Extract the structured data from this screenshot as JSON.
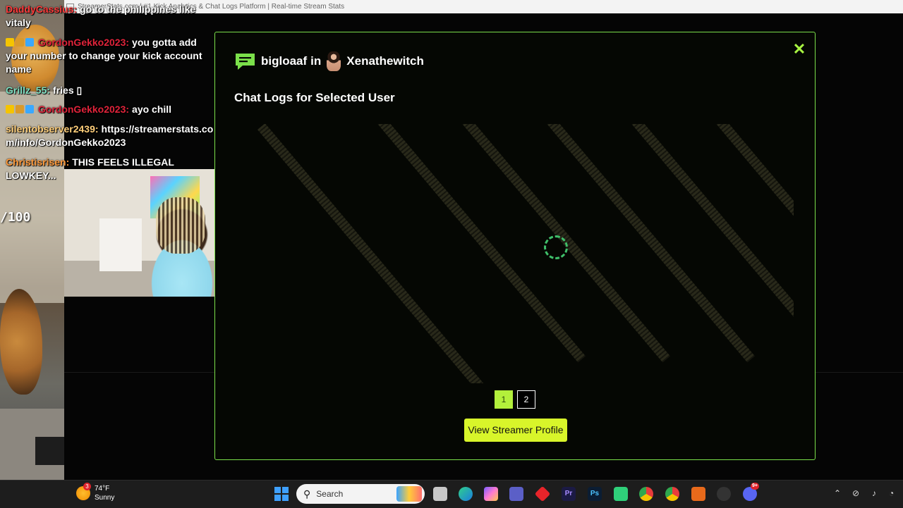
{
  "browser": {
    "title": "StreamerStats.com | #1 Kick Analytics & Chat Logs Platform | Real-time Stream Stats"
  },
  "chat_overlay": {
    "messages": [
      {
        "user": "DaddyCassius:",
        "text": "go to the philippines like vitaly",
        "color": "#ff3b3b"
      },
      {
        "user": "GordonGekko2023:",
        "text": "you gotta add your number to change your kick account name",
        "color": "#e0233a"
      },
      {
        "user": "Grillz_55:",
        "text": "fries ▯",
        "color": "#7ee0c2"
      },
      {
        "user": "GordonGekko2023:",
        "text": "ayo chill",
        "color": "#e0233a"
      },
      {
        "user": "silentobserver2439:",
        "text": "https://streamerstats.com/info/GordonGekko2023",
        "color": "#ffcf7a"
      },
      {
        "user": "Christisrisen:",
        "text": "THIS FEELS ILLEGAL LOWKEY...",
        "color": "#ff9a3b"
      }
    ],
    "score": "/100"
  },
  "modal": {
    "username": "bigloaaf",
    "in_word": "in",
    "streamer": "Xenathewitch",
    "section_title": "Chat Logs for Selected User",
    "pages": [
      "1",
      "2"
    ],
    "active_page": "1",
    "view_button": "View Streamer Profile",
    "close_icon": "close-icon",
    "accent_color": "#7be04a"
  },
  "taskbar": {
    "weather": {
      "badge": "3",
      "temp": "74°F",
      "condition": "Sunny"
    },
    "search_placeholder": "Search",
    "notification_badge": "9+"
  }
}
